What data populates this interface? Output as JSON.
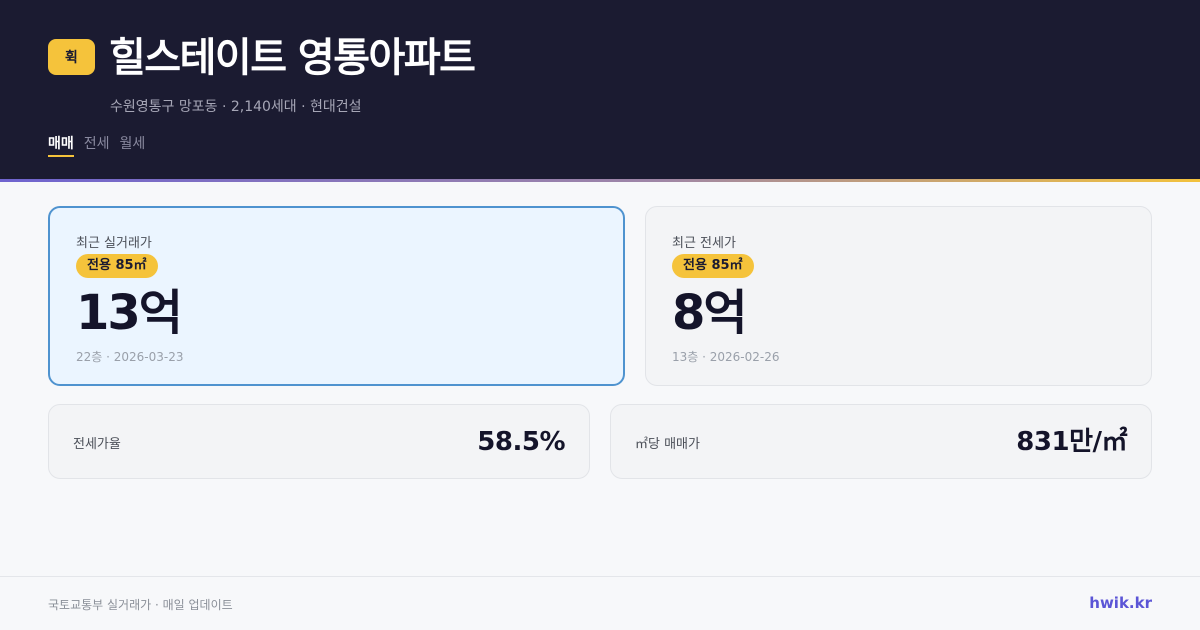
{
  "header": {
    "logo_char": "휙",
    "title": "힐스테이트 영통아파트",
    "subtitle": "수원영통구 망포동 · 2,140세대 · 현대건설",
    "tabs": [
      {
        "label": "매매",
        "active": true
      },
      {
        "label": "전세",
        "active": false
      },
      {
        "label": "월세",
        "active": false
      }
    ]
  },
  "cards": {
    "sale": {
      "label": "최근 실거래가",
      "area_badge": "전용 85㎡",
      "price": "13억",
      "meta": "22층 · 2026-03-23"
    },
    "jeonse": {
      "label": "최근 전세가",
      "area_badge": "전용 85㎡",
      "price": "8억",
      "meta": "13층 · 2026-02-26"
    }
  },
  "stats": {
    "jeonse_ratio": {
      "label": "전세가율",
      "value": "58.5%"
    },
    "price_per_m2": {
      "label": "㎡당 매매가",
      "value": "831만/㎡"
    }
  },
  "footer": {
    "note": "국토교통부 실거래가 · 매일 업데이트",
    "brand": "hwik.kr"
  },
  "colors": {
    "header_bg": "#1b1b31",
    "accent": "#f5c33b",
    "brand": "#5b55d6",
    "highlight_border": "#4f93cf",
    "highlight_bg": "#ebf5ff"
  }
}
